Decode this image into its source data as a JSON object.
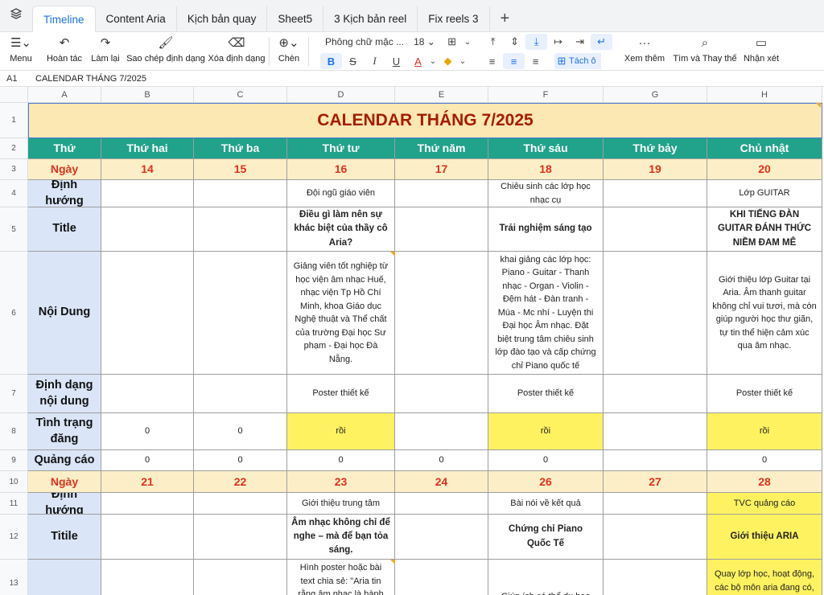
{
  "tabs": [
    "Timeline",
    "Content Aria",
    "Kịch bản quay",
    "Sheet5",
    "3 Kịch bản reel",
    "Fix reels 3"
  ],
  "toolbar": {
    "menu": "Menu",
    "undo": "Hoàn tác",
    "redo": "Làm lại",
    "paint_format": "Sao chép định dạng",
    "clear_format": "Xóa định dạng",
    "insert": "Chèn",
    "font": "Phông chữ mặc ...",
    "font_size": "18",
    "merge": "Tách ô",
    "more": "Xem thêm",
    "find": "Tìm và Thay thế",
    "comment": "Nhận xét"
  },
  "formula": {
    "cell": "A1",
    "value": "CALENDAR THÁNG 7/2025"
  },
  "columns": [
    "A",
    "B",
    "C",
    "D",
    "E",
    "F",
    "G",
    "H"
  ],
  "rows": [
    "1",
    "2",
    "3",
    "4",
    "5",
    "6",
    "7",
    "8",
    "9",
    "10",
    "11",
    "12",
    "13"
  ],
  "sheet": {
    "title": "CALENDAR THÁNG 7/2025",
    "days": [
      "Thứ",
      "Thứ hai",
      "Thứ ba",
      "Thứ tư",
      "Thứ năm",
      "Thứ sáu",
      "Thứ bảy",
      "Chủ nhật"
    ],
    "week1_dates": [
      "Ngày",
      "14",
      "15",
      "16",
      "17",
      "18",
      "19",
      "20"
    ],
    "week2_dates": [
      "Ngày",
      "21",
      "22",
      "23",
      "24",
      "26",
      "27",
      "28"
    ],
    "labels": {
      "dinh_huong": "Định hướng",
      "title": "Title",
      "noi_dung": "Nội Dung",
      "dinh_dang": "Định dạng nội dung",
      "tinh_trang": "Tình trạng đăng",
      "quang_cao": "Quảng cáo",
      "titile": "Titile"
    },
    "w1": {
      "d_dinh_huong": "Đội ngũ giáo viên",
      "f_dinh_huong": "Chiêu sinh các lớp học nhạc cụ",
      "h_dinh_huong": "Lớp GUITAR",
      "d_title": "Điều gì làm nên sự khác biệt của thầy cô Aria?",
      "f_title": "Trải nghiệm sáng tạo",
      "h_title": "KHI TIẾNG ĐÀN GUITAR ĐÁNH THỨC NIỀM ĐAM MÊ",
      "d_noi_dung": "Giảng viên tốt nghiệp từ học viện âm nhạc Huế, nhạc viện Tp Hồ Chí Minh, khoa Giáo dục Nghệ thuật và Thể chất của trường Đại học Sư phạm - Đại học Đà Nẵng.",
      "f_noi_dung": "khai giảng các lớp học: Piano - Guitar - Thanh nhạc - Organ - Violin - Đệm hát  - Đàn tranh - Múa - Mc nhí - Luyện thi Đại học Âm nhạc. Đặt biệt trung tâm chiêu sinh lớp đào tạo và cấp chứng chỉ  Piano quốc tế",
      "h_noi_dung": "Giới thiệu lớp Guitar tại Aria. Âm thanh guitar không chỉ vui tươi, mà còn giúp người học thư giãn, tự tin thể hiện cảm xúc qua âm nhạc.",
      "poster": "Poster thiết kế",
      "roi": "rồi",
      "zero": "0"
    },
    "w2": {
      "d_dinh_huong": "Giới thiệu trung tâm",
      "f_dinh_huong": "Bài nói về kết quả",
      "h_dinh_huong": "TVC quảng cáo",
      "d_title": "Âm nhạc không chỉ để nghe – mà để bạn tỏa sáng.",
      "f_title": "Chứng chỉ Piano Quốc Tế",
      "h_title": "Giới thiệu ARIA",
      "d_noi_dung": "Hình poster hoặc bài text chia sẻ: \"Aria tin rằng âm nhạc là hành",
      "f_noi_dung": "Giúp ích cá thể du học",
      "h_noi_dung": "Quay lớp học, hoạt động, các bộ môn aria đang có,"
    }
  }
}
